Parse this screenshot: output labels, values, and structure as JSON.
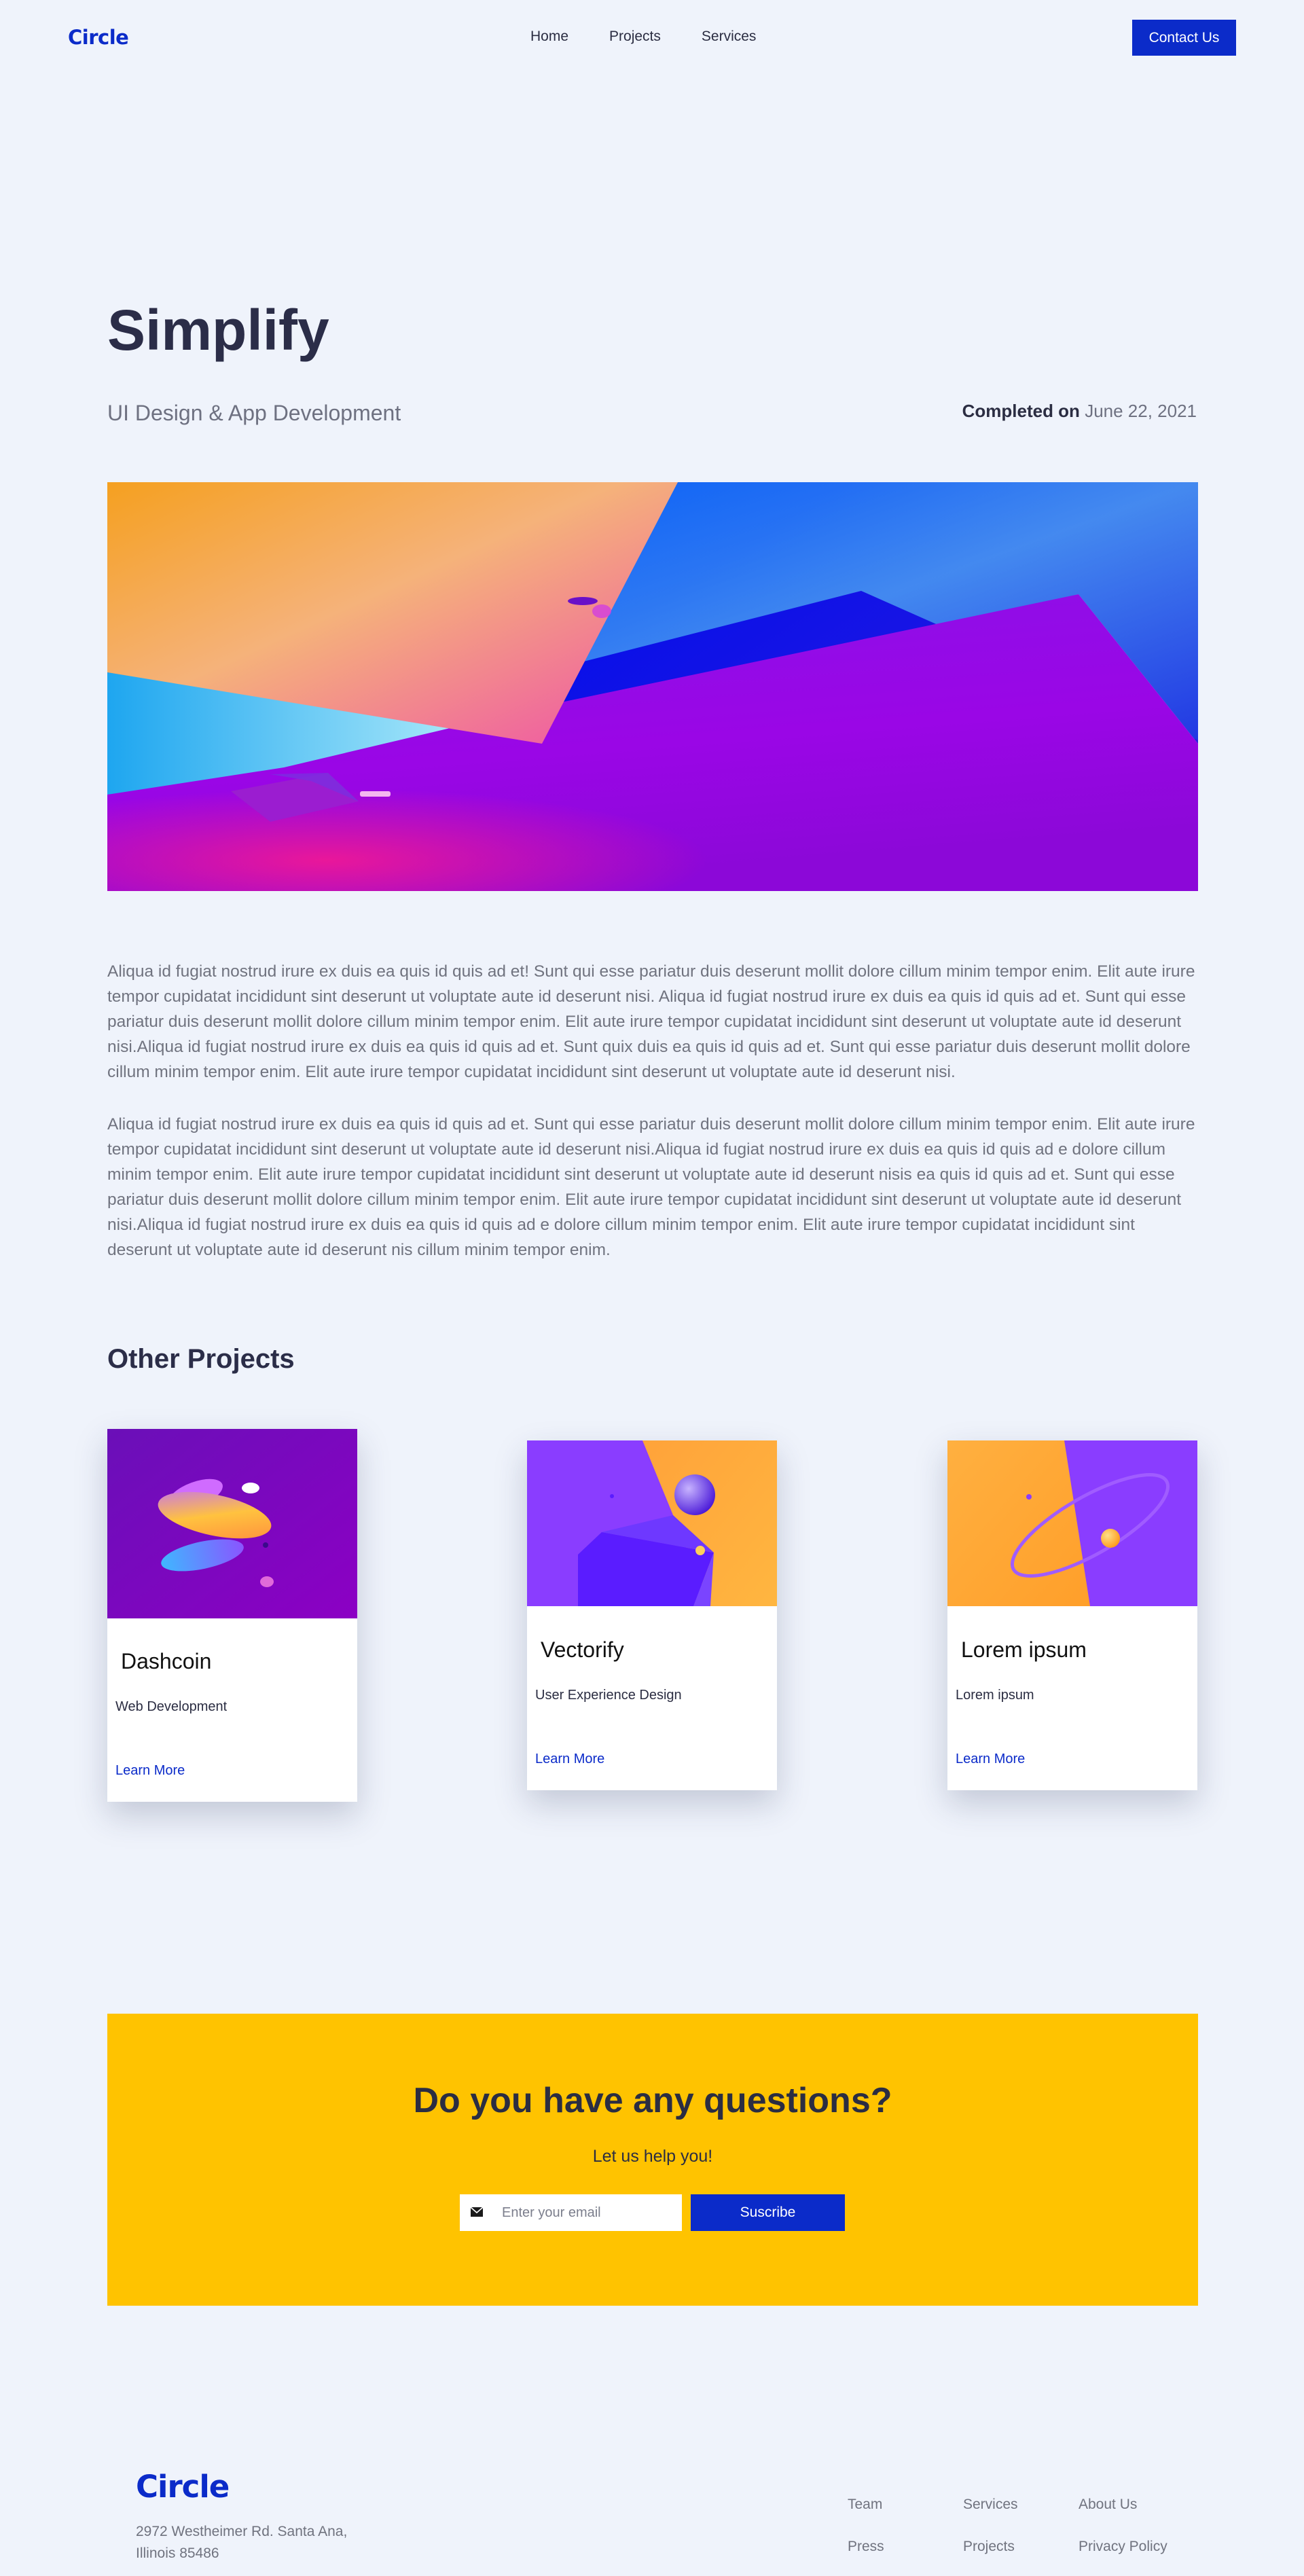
{
  "nav": {
    "logo": "Circle",
    "links": [
      "Home",
      "Projects",
      "Services"
    ],
    "contact_label": "Contact Us"
  },
  "hero": {
    "title": "Simplify",
    "subtitle": "UI Design & App Development",
    "completed_label": "Completed on",
    "completed_date": "June 22, 2021"
  },
  "body": {
    "paragraphs": [
      "Aliqua id fugiat nostrud irure ex duis ea quis id quis ad et! Sunt qui esse pariatur duis deserunt mollit dolore cillum minim tempor enim. Elit aute irure tempor cupidatat incididunt sint deserunt ut voluptate aute id deserunt nisi. Aliqua id fugiat nostrud irure ex duis ea quis id quis ad et. Sunt qui esse pariatur duis deserunt mollit dolore cillum minim tempor enim. Elit aute irure tempor cupidatat incididunt sint deserunt ut voluptate aute id deserunt nisi.Aliqua id fugiat nostrud irure ex duis ea quis id quis ad et. Sunt quix duis ea quis id quis ad et. Sunt qui esse pariatur duis deserunt mollit dolore cillum minim tempor enim. Elit aute irure tempor cupidatat incididunt sint deserunt ut voluptate aute id deserunt nisi.",
      "Aliqua id fugiat nostrud irure ex duis ea quis id quis ad et. Sunt qui esse pariatur duis deserunt mollit dolore cillum minim tempor enim. Elit aute irure tempor cupidatat incididunt sint deserunt ut voluptate aute id deserunt nisi.Aliqua id fugiat nostrud irure ex duis ea quis id quis ad e dolore cillum minim tempor enim. Elit aute irure tempor cupidatat incididunt sint deserunt ut voluptate aute id deserunt nisis ea quis id quis ad et. Sunt qui esse pariatur duis deserunt mollit dolore cillum minim tempor enim. Elit aute irure tempor cupidatat incididunt sint deserunt ut voluptate aute id deserunt nisi.Aliqua id fugiat nostrud irure ex duis ea quis id quis ad e dolore cillum minim tempor enim. Elit aute irure tempor cupidatat incididunt sint deserunt ut voluptate aute id deserunt nis cillum minim tempor enim."
    ]
  },
  "projects": {
    "heading": "Other Projects",
    "cards": [
      {
        "title": "Dashcoin",
        "category": "Web Development",
        "link": "Learn More"
      },
      {
        "title": "Vectorify",
        "category": "User Experience Design",
        "link": "Learn More"
      },
      {
        "title": "Lorem ipsum",
        "category": "Lorem ipsum",
        "link": "Learn More"
      }
    ]
  },
  "cta": {
    "title": "Do you have any questions?",
    "subtitle": "Let us help you!",
    "email_placeholder": "Enter your email",
    "button_label": "Suscribe"
  },
  "footer": {
    "logo": "Circle",
    "address": "2972 Westheimer Rd. Santa Ana, Illinois 85486",
    "links": [
      "Team",
      "Services",
      "About Us",
      "Press",
      "Projects",
      "Privacy Policy"
    ]
  },
  "colors": {
    "accent": "#0b2bc9",
    "cta_background": "#ffc300",
    "page_background": "#eff3fb"
  }
}
